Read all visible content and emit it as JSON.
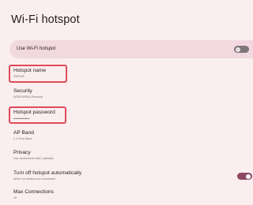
{
  "page": {
    "title": "Wi-Fi hotspot"
  },
  "master": {
    "label": "Use Wi-Fi hotspot",
    "state": "off"
  },
  "settings": [
    {
      "title": "Hotspot name",
      "subtitle": "SNP118",
      "highlighted": true
    },
    {
      "title": "Security",
      "subtitle": "WPA2/WPA3-Personal",
      "highlighted": false
    },
    {
      "title": "Hotspot password",
      "subtitle": "•••••••••••••••",
      "highlighted": true
    },
    {
      "title": "AP Band",
      "subtitle": "2.4 GHz Band",
      "highlighted": false
    },
    {
      "title": "Privacy",
      "subtitle": "Use randomized MAC (default)",
      "highlighted": false
    },
    {
      "title": "Turn off hotspot automatically",
      "subtitle": "When no devices are connected",
      "toggle": "on",
      "highlighted": false
    },
    {
      "title": "Max Connections",
      "subtitle": "10",
      "highlighted": false
    }
  ],
  "colors": {
    "background": "#fbeeee",
    "card": "#f1d9df",
    "highlight": "#e04a5a",
    "toggle_on": "#8a4968",
    "toggle_off": "#7e7578"
  },
  "icons": {
    "master_toggle": "toggle-off-icon",
    "auto_off_toggle": "toggle-on-icon"
  }
}
